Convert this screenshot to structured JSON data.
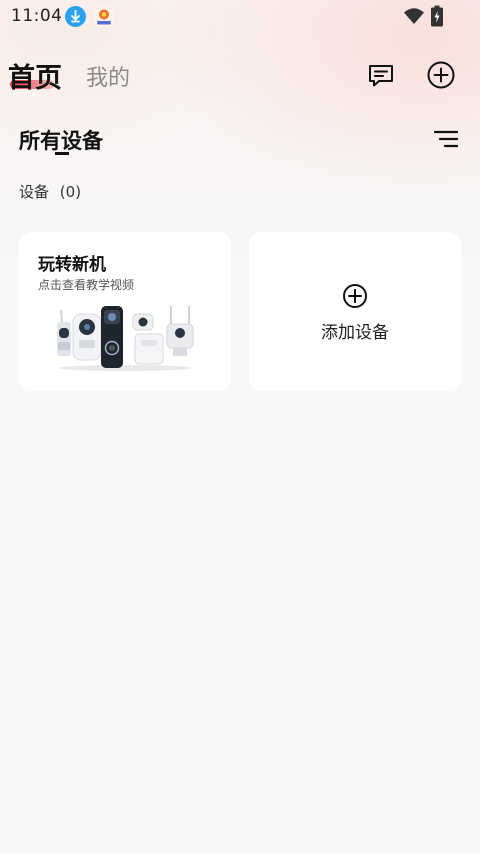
{
  "status_bar": {
    "time": "11:04",
    "icons": [
      "download-icon",
      "app-notification-icon",
      "wifi-icon",
      "battery-charging-icon"
    ]
  },
  "header": {
    "tabs": [
      {
        "label": "首页",
        "active": true
      },
      {
        "label": "我的",
        "active": false
      }
    ],
    "actions": [
      "message-icon",
      "add-circle-icon"
    ]
  },
  "section": {
    "title": "所有设备",
    "count_label": "设备",
    "count": "(0)",
    "sort_icon": "sort-icon"
  },
  "cards": {
    "promo": {
      "title": "玩转新机",
      "subtitle": "点击查看教学视频"
    },
    "add": {
      "label": "添加设备",
      "icon": "add-circle-icon"
    }
  },
  "colors": {
    "accent": "#e23b4a",
    "download_badge": "#2aa1f0",
    "page_background": "#f7f7f7",
    "card_background": "#ffffff"
  }
}
